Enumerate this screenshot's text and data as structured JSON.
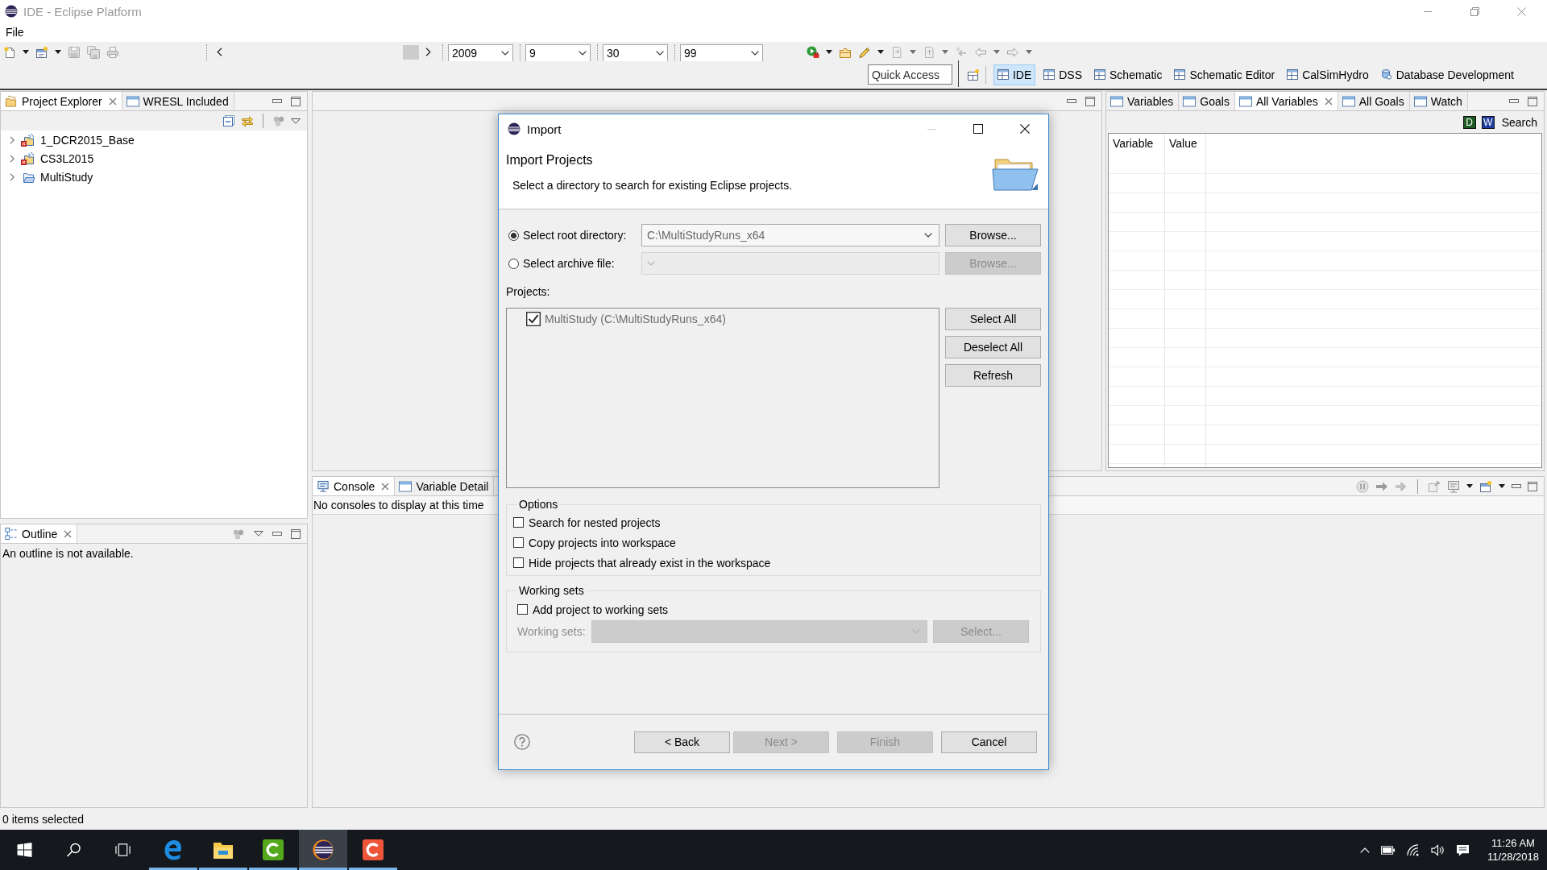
{
  "window": {
    "title": "IDE - Eclipse Platform"
  },
  "menu": [
    "File"
  ],
  "toolbar": {
    "dropdowns": [
      "2009",
      "9",
      "30",
      "99"
    ],
    "quick_access": {
      "placeholder": "Quick Access"
    }
  },
  "perspectives": [
    {
      "label": "IDE",
      "kind": "grid",
      "selected": true
    },
    {
      "label": "DSS",
      "kind": "grid",
      "selected": false
    },
    {
      "label": "Schematic",
      "kind": "grid",
      "selected": false
    },
    {
      "label": "Schematic Editor",
      "kind": "grid",
      "selected": false
    },
    {
      "label": "CalSimHydro",
      "kind": "grid",
      "selected": false
    },
    {
      "label": "Database Development",
      "kind": "database",
      "selected": false
    }
  ],
  "project_explorer": {
    "tabs": [
      {
        "label": "Project Explorer",
        "kind": "explorer",
        "selected": true
      },
      {
        "label": "WRESL Included",
        "kind": "view",
        "selected": false
      }
    ],
    "tree": [
      {
        "label": "1_DCR2015_Base",
        "kind": "project-error",
        "expanded": false
      },
      {
        "label": "CS3L2015",
        "kind": "project-error",
        "expanded": false
      },
      {
        "label": "MultiStudy",
        "kind": "folder",
        "expanded": false
      }
    ]
  },
  "outline": {
    "tabs": [
      {
        "label": "Outline",
        "kind": "outline",
        "selected": true
      }
    ],
    "message": "An outline is not available."
  },
  "variables_view": {
    "tabs": [
      {
        "label": "Variables",
        "kind": "view",
        "selected": false
      },
      {
        "label": "Goals",
        "kind": "view",
        "selected": false
      },
      {
        "label": "All Variables",
        "kind": "view",
        "selected": true
      },
      {
        "label": "All Goals",
        "kind": "view",
        "selected": false
      },
      {
        "label": "Watch",
        "kind": "view",
        "selected": false
      }
    ],
    "toggles": [
      {
        "letter": "D",
        "color": "#1d5a24"
      },
      {
        "letter": "W",
        "color": "#1f3d9e"
      }
    ],
    "search_label": "Search",
    "columns": [
      "Variable",
      "Value"
    ]
  },
  "console": {
    "tabs": [
      {
        "label": "Console",
        "kind": "console",
        "selected": true
      },
      {
        "label": "Variable Detail",
        "kind": "view",
        "selected": false
      }
    ],
    "message": "No consoles to display at this time"
  },
  "status_bar": "0 items selected",
  "import_dialog": {
    "title": "Import",
    "heading": "Import Projects",
    "description": "Select a directory to search for existing Eclipse projects.",
    "sources": [
      {
        "label": "Select root directory:",
        "selected": true,
        "value": "C:\\MultiStudyRuns_x64",
        "button": "Browse..."
      },
      {
        "label": "Select archive file:",
        "selected": false,
        "button": "Browse..."
      }
    ],
    "projects_label": "Projects:",
    "projects": [
      {
        "label": "MultiStudy (C:\\MultiStudyRuns_x64)",
        "checked": true
      }
    ],
    "list_buttons": [
      "Select All",
      "Deselect All",
      "Refresh"
    ],
    "options": {
      "title": "Options",
      "items": [
        {
          "label": "Search for nested projects",
          "checked": false
        },
        {
          "label": "Copy projects into workspace",
          "checked": false
        },
        {
          "label": "Hide projects that already exist in the workspace",
          "checked": false
        }
      ]
    },
    "working_sets": {
      "title": "Working sets",
      "add": {
        "label": "Add project to working sets",
        "checked": false
      },
      "field_label": "Working sets:",
      "button": "Select..."
    },
    "buttons": [
      {
        "label": "< Back",
        "disabled": false
      },
      {
        "label": "Next >",
        "disabled": true
      },
      {
        "label": "Finish",
        "disabled": true
      },
      {
        "label": "Cancel",
        "disabled": false
      }
    ]
  },
  "taskbar": {
    "apps": [
      {
        "kind": "browser",
        "selected": false
      },
      {
        "kind": "file-manager",
        "selected": false
      },
      {
        "kind": "letter-tile",
        "color": "#54a81c",
        "selected": false
      },
      {
        "kind": "ide",
        "selected": true
      },
      {
        "kind": "letter-tile",
        "color": "#ef5539",
        "selected": false
      }
    ],
    "time": "11:26 AM",
    "date": "11/28/2018"
  }
}
